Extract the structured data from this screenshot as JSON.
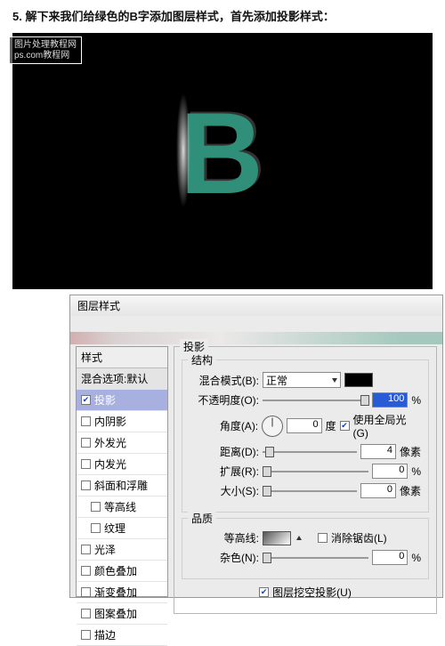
{
  "instruction": "5. 解下来我们给绿色的B字添加图层样式，首先添加投影样式：",
  "watermark": {
    "line1": "图片处理教程网",
    "line2": "ps.com教程网"
  },
  "letter": "B",
  "dialog": {
    "title": "图层样式"
  },
  "styles": {
    "header": "样式",
    "default_label": "混合选项:默认",
    "items": [
      {
        "label": "投影",
        "checked": true,
        "selected": true
      },
      {
        "label": "内阴影",
        "checked": false
      },
      {
        "label": "外发光",
        "checked": false
      },
      {
        "label": "内发光",
        "checked": false
      },
      {
        "label": "斜面和浮雕",
        "checked": false
      },
      {
        "label": "等高线",
        "checked": false,
        "indent": true
      },
      {
        "label": "纹理",
        "checked": false,
        "indent": true
      },
      {
        "label": "光泽",
        "checked": false
      },
      {
        "label": "颜色叠加",
        "checked": false
      },
      {
        "label": "渐变叠加",
        "checked": false
      },
      {
        "label": "图案叠加",
        "checked": false
      },
      {
        "label": "描边",
        "checked": false
      }
    ]
  },
  "shadow": {
    "title": "投影",
    "structure": {
      "title": "结构",
      "blend_label": "混合模式(B):",
      "blend_value": "正常",
      "opacity_label": "不透明度(O):",
      "opacity_value": "100",
      "opacity_unit": "%",
      "angle_label": "角度(A):",
      "angle_value": "0",
      "angle_unit": "度",
      "global_label": "使用全局光(G)",
      "distance_label": "距离(D):",
      "distance_value": "4",
      "distance_unit": "像素",
      "spread_label": "扩展(R):",
      "spread_value": "0",
      "spread_unit": "%",
      "size_label": "大小(S):",
      "size_value": "0",
      "size_unit": "像素"
    },
    "quality": {
      "title": "品质",
      "contour_label": "等高线:",
      "antialias_label": "消除锯齿(L)",
      "noise_label": "杂色(N):",
      "noise_value": "0",
      "noise_unit": "%"
    },
    "knockout_label": "图层挖空投影(U)"
  }
}
